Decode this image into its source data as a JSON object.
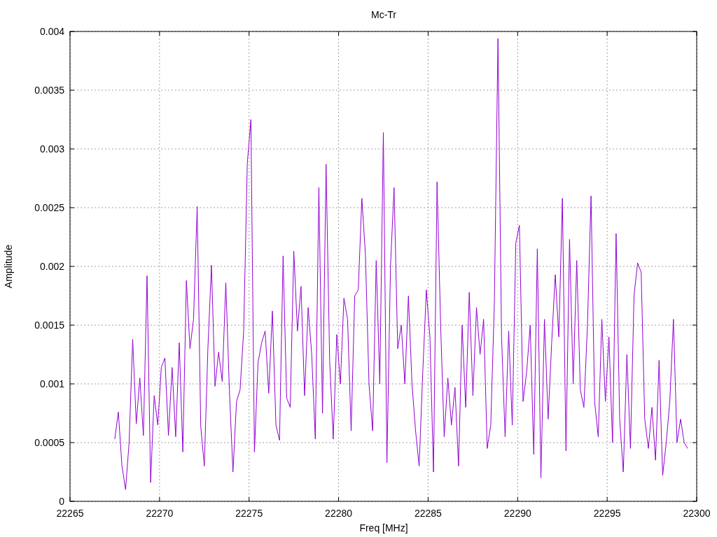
{
  "chart_data": {
    "type": "line",
    "title": "Mc-Tr",
    "xlabel": "Freq [MHz]",
    "ylabel": "Amplitude",
    "grid": true,
    "xlim": [
      22265,
      22300
    ],
    "ylim": [
      0,
      0.004
    ],
    "xticks": [
      22265,
      22270,
      22275,
      22280,
      22285,
      22290,
      22295,
      22300
    ],
    "yticks": [
      0,
      0.0005,
      0.001,
      0.0015,
      0.002,
      0.0025,
      0.003,
      0.0035,
      0.004
    ],
    "x": [
      22267.5,
      22267.7,
      22267.9,
      22268.1,
      22268.3,
      22268.5,
      22268.7,
      22268.9,
      22269.1,
      22269.3,
      22269.5,
      22269.7,
      22269.9,
      22270.1,
      22270.3,
      22270.5,
      22270.7,
      22270.9,
      22271.1,
      22271.3,
      22271.5,
      22271.7,
      22271.9,
      22272.1,
      22272.3,
      22272.5,
      22272.7,
      22272.9,
      22273.1,
      22273.3,
      22273.5,
      22273.7,
      22273.9,
      22274.1,
      22274.3,
      22274.5,
      22274.7,
      22274.9,
      22275.1,
      22275.3,
      22275.5,
      22275.7,
      22275.9,
      22276.1,
      22276.3,
      22276.5,
      22276.7,
      22276.9,
      22277.1,
      22277.3,
      22277.5,
      22277.7,
      22277.9,
      22278.1,
      22278.3,
      22278.5,
      22278.7,
      22278.9,
      22279.1,
      22279.3,
      22279.5,
      22279.7,
      22279.9,
      22280.1,
      22280.3,
      22280.5,
      22280.7,
      22280.9,
      22281.1,
      22281.3,
      22281.5,
      22281.7,
      22281.9,
      22282.1,
      22282.3,
      22282.5,
      22282.7,
      22282.9,
      22283.1,
      22283.3,
      22283.5,
      22283.7,
      22283.9,
      22284.1,
      22284.3,
      22284.5,
      22284.7,
      22284.9,
      22285.1,
      22285.3,
      22285.5,
      22285.7,
      22285.9,
      22286.1,
      22286.3,
      22286.5,
      22286.7,
      22286.9,
      22287.1,
      22287.3,
      22287.5,
      22287.7,
      22287.9,
      22288.1,
      22288.3,
      22288.5,
      22288.7,
      22288.9,
      22289.1,
      22289.3,
      22289.5,
      22289.7,
      22289.9,
      22290.1,
      22290.3,
      22290.5,
      22290.7,
      22290.9,
      22291.1,
      22291.3,
      22291.5,
      22291.7,
      22291.9,
      22292.1,
      22292.3,
      22292.5,
      22292.7,
      22292.9,
      22293.1,
      22293.3,
      22293.5,
      22293.7,
      22293.9,
      22294.1,
      22294.3,
      22294.5,
      22294.7,
      22294.9,
      22295.1,
      22295.3,
      22295.5,
      22295.7,
      22295.9,
      22296.1,
      22296.3,
      22296.5,
      22296.7,
      22296.9,
      22297.1,
      22297.3,
      22297.5,
      22297.7,
      22297.9,
      22298.1,
      22298.3,
      22298.5,
      22298.7,
      22298.9,
      22299.1,
      22299.3,
      22299.5
    ],
    "series": [
      {
        "color": "#9400d3",
        "values": [
          0.00053,
          0.00076,
          0.0003,
          0.0001,
          0.0005,
          0.00138,
          0.00066,
          0.00105,
          0.00056,
          0.00192,
          0.00016,
          0.0009,
          0.00065,
          0.00114,
          0.00122,
          0.00056,
          0.00114,
          0.00055,
          0.00135,
          0.00042,
          0.00188,
          0.0013,
          0.00155,
          0.00251,
          0.00064,
          0.0003,
          0.0013,
          0.00201,
          0.00098,
          0.00127,
          0.00102,
          0.00186,
          0.00095,
          0.00025,
          0.00085,
          0.00095,
          0.00145,
          0.00288,
          0.00325,
          0.00042,
          0.00118,
          0.00135,
          0.00145,
          0.00092,
          0.00162,
          0.00065,
          0.00052,
          0.00209,
          0.00088,
          0.0008,
          0.00213,
          0.00145,
          0.00183,
          0.0009,
          0.00165,
          0.00125,
          0.00053,
          0.00267,
          0.00075,
          0.00287,
          0.0012,
          0.00053,
          0.00142,
          0.001,
          0.00173,
          0.00155,
          0.0006,
          0.00175,
          0.0018,
          0.00258,
          0.0021,
          0.001,
          0.0006,
          0.00205,
          0.001,
          0.00314,
          0.00033,
          0.002,
          0.00267,
          0.0013,
          0.0015,
          0.001,
          0.00175,
          0.001,
          0.0006,
          0.0003,
          0.0011,
          0.0018,
          0.0014,
          0.00025,
          0.00272,
          0.0015,
          0.00055,
          0.00105,
          0.00065,
          0.00097,
          0.0003,
          0.0015,
          0.0008,
          0.00178,
          0.0009,
          0.00165,
          0.00125,
          0.00155,
          0.00045,
          0.00065,
          0.00168,
          0.00394,
          0.0014,
          0.00055,
          0.00145,
          0.00065,
          0.0022,
          0.00235,
          0.00085,
          0.0011,
          0.0015,
          0.0004,
          0.00215,
          0.0002,
          0.00155,
          0.0007,
          0.00135,
          0.00193,
          0.0014,
          0.00258,
          0.00043,
          0.00223,
          0.001,
          0.00205,
          0.00095,
          0.0008,
          0.0015,
          0.0026,
          0.00085,
          0.00055,
          0.00155,
          0.00085,
          0.0014,
          0.0005,
          0.00228,
          0.0007,
          0.00025,
          0.00125,
          0.00045,
          0.00175,
          0.00203,
          0.00195,
          0.0007,
          0.00045,
          0.0008,
          0.00035,
          0.0012,
          0.00022,
          0.0005,
          0.00085,
          0.00155,
          0.0005,
          0.0007,
          0.0005,
          0.00045
        ]
      }
    ]
  }
}
